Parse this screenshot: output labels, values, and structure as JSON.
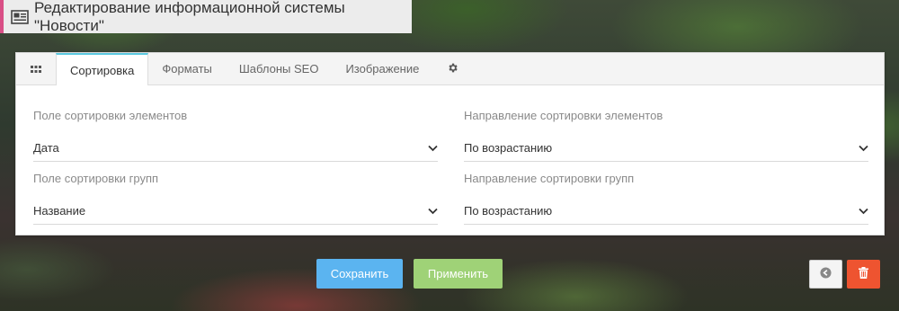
{
  "header": {
    "title": "Редактирование информационной системы \"Новости\"",
    "icon": "newspaper-icon"
  },
  "tabs": [
    {
      "label": "Сортировка",
      "active": true
    },
    {
      "label": "Форматы"
    },
    {
      "label": "Шаблоны SEO"
    },
    {
      "label": "Изображение"
    }
  ],
  "fields": {
    "items_sort_field": {
      "label": "Поле сортировки элементов",
      "value": "Дата"
    },
    "items_sort_direction": {
      "label": "Направление сортировки элементов",
      "value": "По возрастанию"
    },
    "groups_sort_field": {
      "label": "Поле сортировки групп",
      "value": "Название"
    },
    "groups_sort_direction": {
      "label": "Направление сортировки групп",
      "value": "По возрастанию"
    }
  },
  "buttons": {
    "save": "Сохранить",
    "apply": "Применить"
  },
  "colors": {
    "save": "#5bb4f0",
    "apply": "#9fd277",
    "delete": "#ee5430",
    "accent": "#d94f86",
    "tab_active": "#5ac8e0"
  }
}
